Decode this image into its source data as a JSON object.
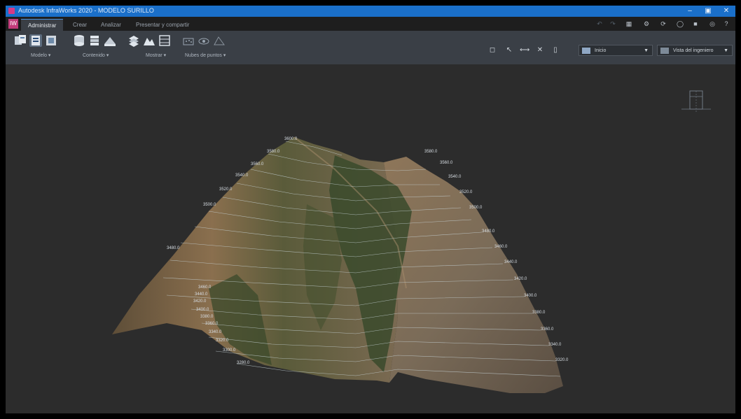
{
  "window": {
    "title": "Autodesk InfraWorks 2020 - MODELO SURILLO"
  },
  "tabs": [
    {
      "label": "Administrar",
      "active": true
    },
    {
      "label": "Crear",
      "active": false
    },
    {
      "label": "Analizar",
      "active": false
    },
    {
      "label": "Presentar y compartir",
      "active": false
    }
  ],
  "ribbon": {
    "groups": [
      {
        "label": "Modelo"
      },
      {
        "label": "Contenido"
      },
      {
        "label": "Mostrar"
      },
      {
        "label": "Nubes de puntos"
      }
    ],
    "view_dropdown": "Inicio",
    "style_dropdown": "Vista del ingeniero"
  },
  "contours": {
    "left": [
      "3600.0",
      "3580.0",
      "3560.0",
      "3540.0",
      "3520.0",
      "3500.0",
      "3480.0",
      "3460.0",
      "3440.0",
      "3420.0",
      "3400.0",
      "3380.0",
      "3360.0",
      "3340.0",
      "3320.0",
      "3300.0",
      "3280.0"
    ],
    "right": [
      "3580.0",
      "3560.0",
      "3540.0",
      "3520.0",
      "3500.0",
      "3480.0",
      "3460.0",
      "3440.0",
      "3420.0",
      "3400.0",
      "3380.0",
      "3360.0",
      "3340.0",
      "3320.0"
    ]
  },
  "colors": {
    "titlebar": "#1a6fc9",
    "ribbon": "#3a3f46",
    "viewport": "#2c2c2c",
    "accent": "#c23b7a"
  }
}
